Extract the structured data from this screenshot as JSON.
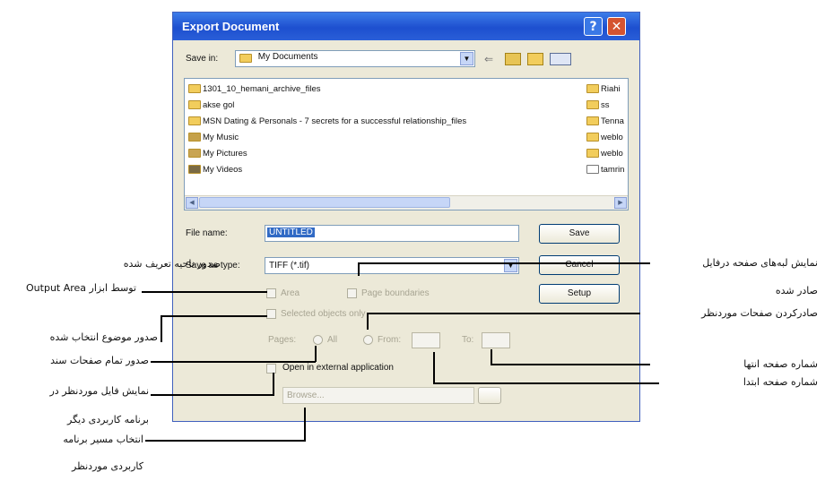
{
  "dialog": {
    "title": "Export Document",
    "help_glyph": "?",
    "close_glyph": "✕",
    "save_in_label": "Save in:",
    "save_in_value": "My Documents",
    "file_name_label": "File name:",
    "file_name_value": "UNTITLED",
    "save_as_type_label": "Save as type:",
    "save_as_type_value": "TIFF (*.tif)",
    "buttons": {
      "save": "Save",
      "cancel": "Cancel",
      "setup": "Setup"
    },
    "files_left": [
      "1301_10_hemani_archive_files",
      "akse gol",
      "MSN Dating & Personals - 7 secrets for a successful relationship_files",
      "My Music",
      "My Pictures",
      "My Videos"
    ],
    "files_right": [
      "Riahi",
      "ss",
      "Tenna",
      "weblo",
      "weblo",
      "tamrin"
    ],
    "options": {
      "area": "Area",
      "page_boundaries": "Page boundaries",
      "selected_objects": "Selected objects only",
      "pages_label": "Pages:",
      "all": "All",
      "from": "From:",
      "to": "To:",
      "open_external": "Open in external application",
      "external_path": "Browse..."
    }
  },
  "annotations": {
    "export_area_1": "صدور ناحیه تعریف شده",
    "export_area_2": "توسط ابزار Output Area",
    "export_selected": "صدور موضوع انتخاب شده",
    "export_all": "صدور تمام صفحات سند",
    "show_file_1": "نمایش فایل موردنظر در",
    "show_file_2": "برنامه کاربردی دیگر",
    "select_path_1": "انتخاب مسیر برنامه",
    "select_path_2": "کاربردی موردنظر",
    "show_lines_1": "نمایش لبه‌های صفحه درفایل",
    "show_lines_2": "صادر شده",
    "export_pages": "صادرکردن صفحات موردنظر",
    "last_page": "شماره صفحه انتها",
    "first_page": "شماره صفحه ابتدا"
  },
  "colors": {
    "titlebar": "#1d4fcf",
    "selection": "#316ac5",
    "dialog_bg": "#ece9d8"
  }
}
